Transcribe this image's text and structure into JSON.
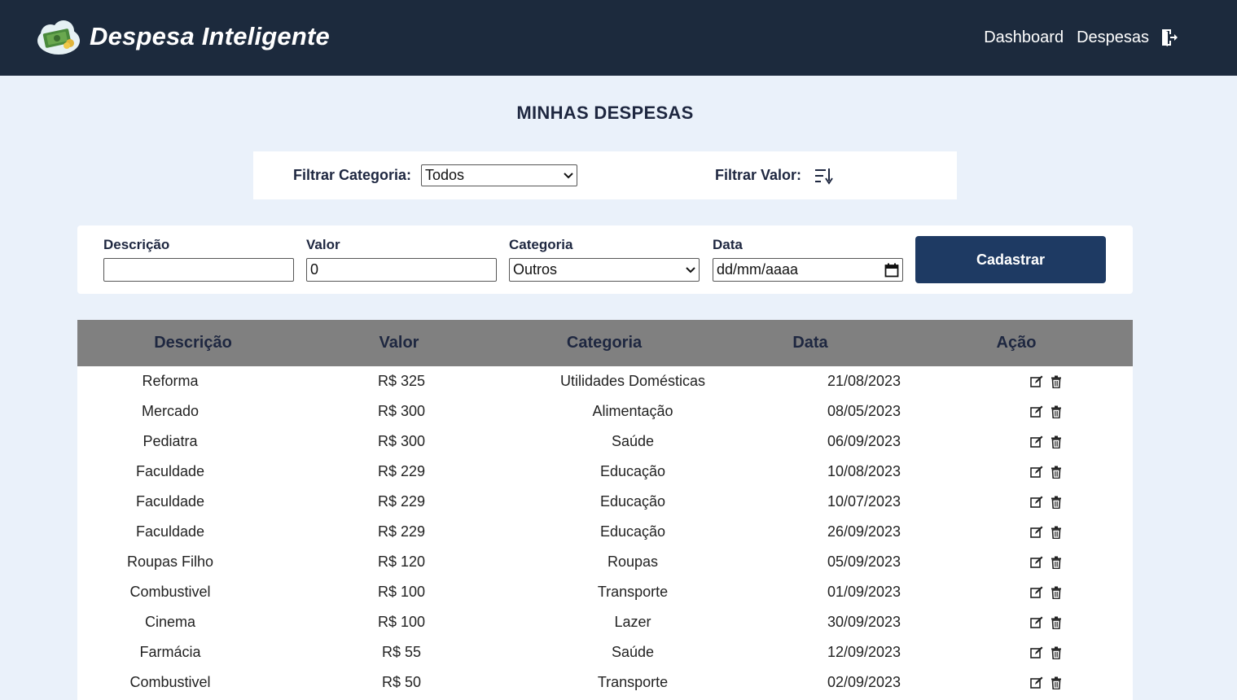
{
  "navbar": {
    "brand": "Despesa Inteligente",
    "links": [
      "Dashboard",
      "Despesas"
    ],
    "logout_icon": "logout-icon"
  },
  "page": {
    "title": "MINHAS DESPESAS"
  },
  "filters": {
    "category_label": "Filtrar Categoria:",
    "category_value": "Todos",
    "value_label": "Filtrar Valor:",
    "sort_icon": "sort-descending-icon"
  },
  "form": {
    "description_label": "Descrição",
    "description_value": "",
    "value_label": "Valor",
    "value_value": "0",
    "category_label": "Categoria",
    "category_value": "Outros",
    "date_label": "Data",
    "date_placeholder": "dd/mm/aaaa",
    "submit_label": "Cadastrar"
  },
  "table": {
    "headers": [
      "Descrição",
      "Valor",
      "Categoria",
      "Data",
      "Ação"
    ],
    "rows": [
      [
        "Reforma",
        "R$ 325",
        "Utilidades Domésticas",
        "21/08/2023"
      ],
      [
        "Mercado",
        "R$ 300",
        "Alimentação",
        "08/05/2023"
      ],
      [
        "Pediatra",
        "R$ 300",
        "Saúde",
        "06/09/2023"
      ],
      [
        "Faculdade",
        "R$ 229",
        "Educação",
        "10/08/2023"
      ],
      [
        "Faculdade",
        "R$ 229",
        "Educação",
        "10/07/2023"
      ],
      [
        "Faculdade",
        "R$ 229",
        "Educação",
        "26/09/2023"
      ],
      [
        "Roupas Filho",
        "R$ 120",
        "Roupas",
        "05/09/2023"
      ],
      [
        "Combustivel",
        "R$ 100",
        "Transporte",
        "01/09/2023"
      ],
      [
        "Cinema",
        "R$ 100",
        "Lazer",
        "30/09/2023"
      ],
      [
        "Farmácia",
        "R$ 55",
        "Saúde",
        "12/09/2023"
      ],
      [
        "Combustivel",
        "R$ 50",
        "Transporte",
        "02/09/2023"
      ]
    ]
  },
  "colors": {
    "navbar": "#1c2a3d",
    "background": "#eaf1fa",
    "button": "#1e3a63",
    "table_header": "#808080"
  }
}
